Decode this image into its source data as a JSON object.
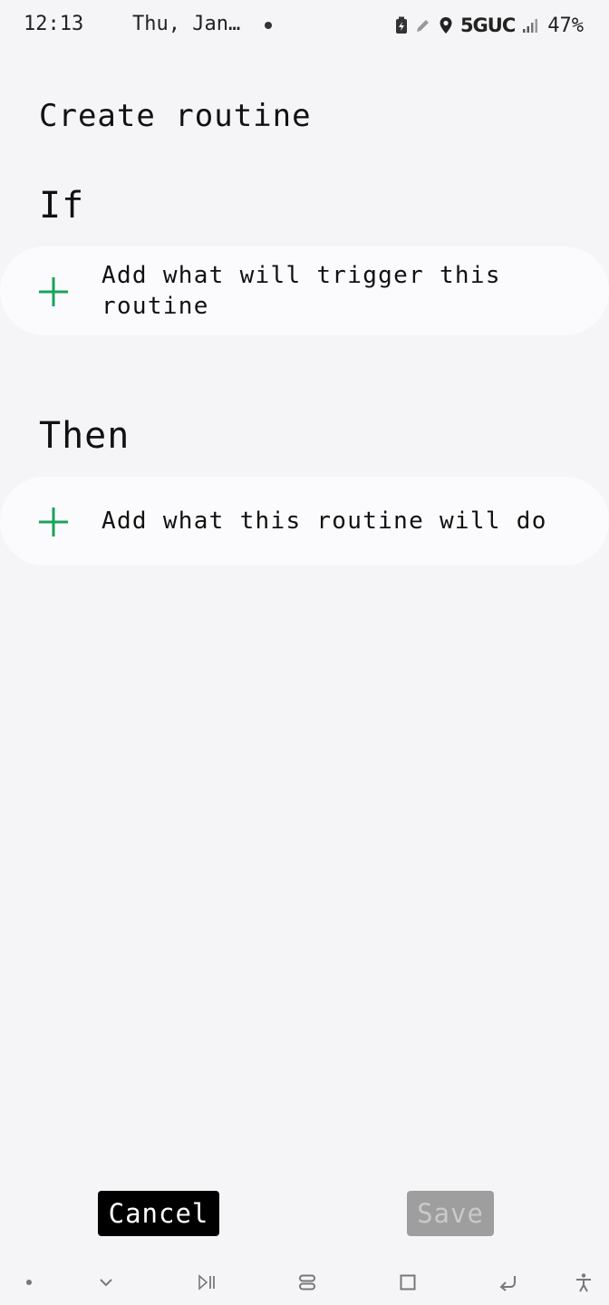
{
  "status_bar": {
    "time": "12:13",
    "date": "Thu, Jan…",
    "network": "5GUC",
    "battery": "47%"
  },
  "page": {
    "title": "Create routine"
  },
  "if_section": {
    "heading": "If",
    "add_label": "Add what will trigger this routine"
  },
  "then_section": {
    "heading": "Then",
    "add_label": "Add what this routine will do"
  },
  "actions": {
    "cancel_label": "Cancel",
    "save_label": "Save",
    "save_enabled": false
  },
  "colors": {
    "accent": "#1aa35a",
    "background": "#f5f5f7",
    "card": "#fbfbfd",
    "cancel_bg": "#000000",
    "save_bg_disabled": "#9e9e9e"
  },
  "nav_bar": {
    "icons": [
      "dot-icon",
      "chevron-down-icon",
      "play-pause-icon",
      "recents-icon",
      "home-icon",
      "back-icon",
      "accessibility-icon"
    ]
  }
}
